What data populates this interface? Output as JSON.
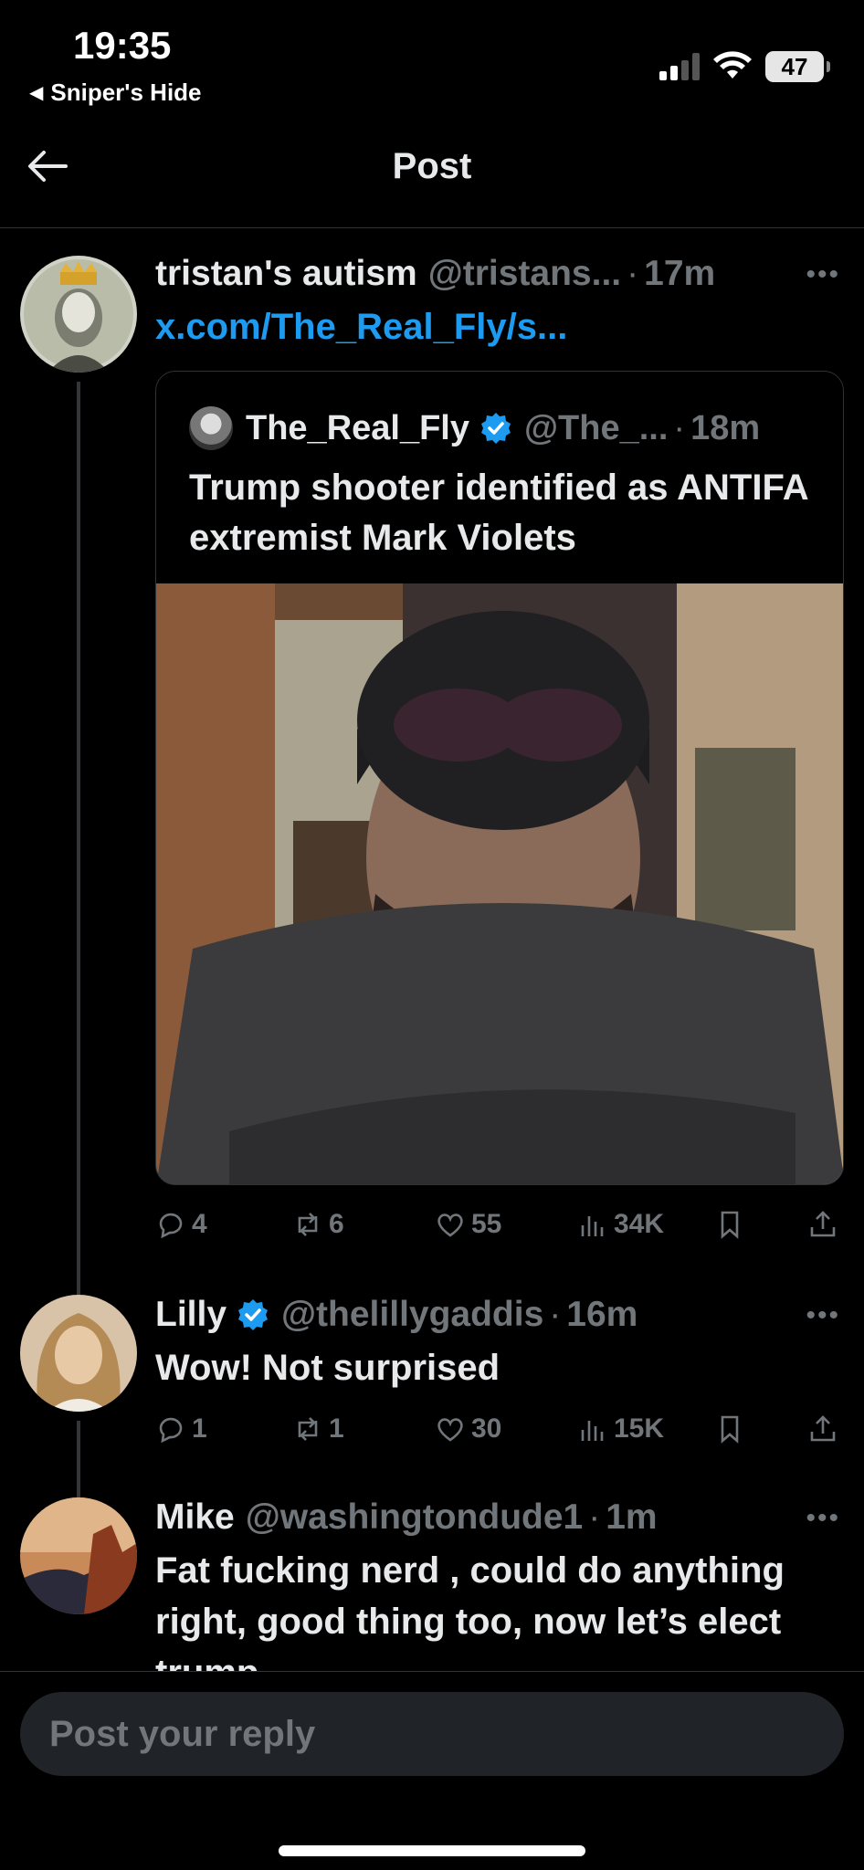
{
  "status_bar": {
    "time": "19:35",
    "back_app": "Sniper's Hide",
    "battery": "47"
  },
  "header": {
    "title": "Post"
  },
  "main_post": {
    "name": "tristan's autism",
    "handle": "@tristans...",
    "time": "17m",
    "link": "x.com/The_Real_Fly/s...",
    "quote": {
      "name": "The_Real_Fly",
      "handle": "@The_...",
      "time": "18m",
      "text": "Trump shooter identified as ANTIFA extremist Mark Violets"
    },
    "stats": {
      "replies": "4",
      "reposts": "6",
      "likes": "55",
      "views": "34K"
    }
  },
  "replies": [
    {
      "name": "Lilly",
      "handle": "@thelillygaddis",
      "time": "16m",
      "text": "Wow! Not surprised",
      "stats": {
        "replies": "1",
        "reposts": "1",
        "likes": "30",
        "views": "15K"
      }
    },
    {
      "name": "Mike",
      "handle": "@washingtondude1",
      "time": "1m",
      "text": "Fat fucking nerd , could do anything right, good thing too, now let’s elect trump"
    }
  ],
  "reply_box": {
    "placeholder": "Post your reply"
  },
  "icons": {
    "back": "arrow-left-icon",
    "reply": "speech-bubble-icon",
    "repost": "repost-icon",
    "like": "heart-icon",
    "views": "bar-chart-icon",
    "bookmark": "bookmark-icon",
    "share": "share-icon",
    "verified": "verified-badge-icon"
  },
  "colors": {
    "accent": "#1d9bf0",
    "muted": "#71767b",
    "background": "#000000"
  }
}
